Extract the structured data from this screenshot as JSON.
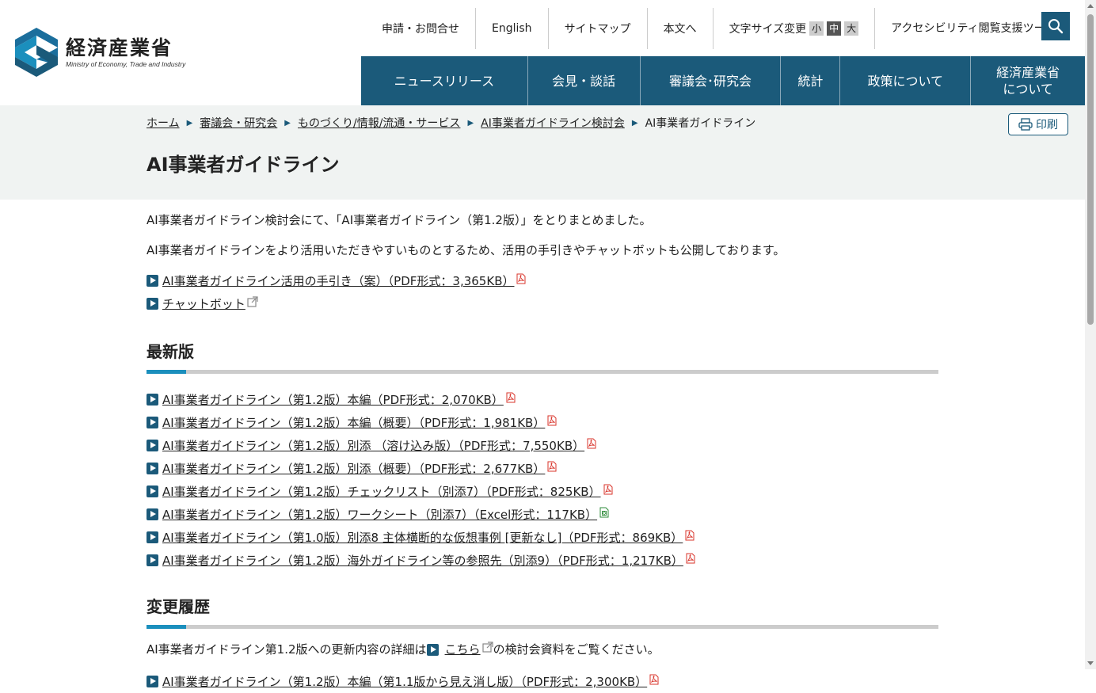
{
  "logo": {
    "jp": "経済産業省",
    "en": "Ministry of Economy, Trade and Industry"
  },
  "util_nav": {
    "contact": "申請・お問合せ",
    "english": "English",
    "sitemap": "サイトマップ",
    "skip": "本文へ",
    "font_size_label": "文字サイズ変更",
    "font_small": "小",
    "font_medium": "中",
    "font_large": "大",
    "accessibility_line1": "アクセシビリティ",
    "accessibility_line2": "閲覧支援ツール"
  },
  "global_nav": {
    "news": "ニュースリリース",
    "press": "会見・談話",
    "council": "審議会･研究会",
    "stats": "統計",
    "policy": "政策について",
    "about_line1": "経済産業省",
    "about_line2": "について"
  },
  "breadcrumb": [
    "ホーム",
    "審議会・研究会",
    "ものづくり/情報/流通・サービス",
    "AI事業者ガイドライン検討会",
    "AI事業者ガイドライン"
  ],
  "print_label": "印刷",
  "page_title": "AI事業者ガイドライン",
  "intro": [
    "AI事業者ガイドライン検討会にて、「AI事業者ガイドライン（第1.2版）」をとりまとめました。",
    "AI事業者ガイドラインをより活用いただきやすいものとするため、活用の手引きやチャットボットも公開しております。"
  ],
  "top_links": [
    {
      "text": "AI事業者ガイドライン活用の手引き（案）（PDF形式：3,365KB）",
      "icon": "pdf-icon"
    },
    {
      "text": "チャットボット",
      "icon": "external-link-icon"
    }
  ],
  "latest": {
    "heading": "最新版",
    "links": [
      {
        "text": "AI事業者ガイドライン（第1.2版）本編（PDF形式：2,070KB）",
        "icon": "pdf-icon"
      },
      {
        "text": "AI事業者ガイドライン（第1.2版）本編（概要）（PDF形式：1,981KB）",
        "icon": "pdf-icon"
      },
      {
        "text": "AI事業者ガイドライン（第1.2版）別添 （溶け込み版）（PDF形式：7,550KB）",
        "icon": "pdf-icon"
      },
      {
        "text": "AI事業者ガイドライン（第1.2版）別添（概要）（PDF形式：2,677KB）",
        "icon": "pdf-icon"
      },
      {
        "text": "AI事業者ガイドライン（第1.2版）チェックリスト（別添7）（PDF形式：825KB）",
        "icon": "pdf-icon"
      },
      {
        "text": "AI事業者ガイドライン（第1.2版）ワークシート（別添7）（Excel形式：117KB）",
        "icon": "excel-icon"
      },
      {
        "text": "AI事業者ガイドライン（第1.0版）別添8 主体横断的な仮想事例 [更新なし]（PDF形式：869KB）",
        "icon": "pdf-icon"
      },
      {
        "text": "AI事業者ガイドライン（第1.2版）海外ガイドライン等の参照先（別添9）（PDF形式：1,217KB）",
        "icon": "pdf-icon"
      }
    ]
  },
  "history": {
    "heading": "変更履歴",
    "text_before": "AI事業者ガイドライン第1.2版への更新内容の詳細は",
    "link": "こちら",
    "text_after": "の検討会資料をご覧ください。",
    "partial_link": "AI事業者ガイドライン（第1.2版）本編（第1.1版から見え消し版）（PDF形式：2,300KB）"
  },
  "colors": {
    "brand": "#1b5a7a",
    "accent": "#1b8fbd",
    "band": "#f0f3f2",
    "pdf": "#d9342b",
    "excel": "#2e8b3a"
  }
}
